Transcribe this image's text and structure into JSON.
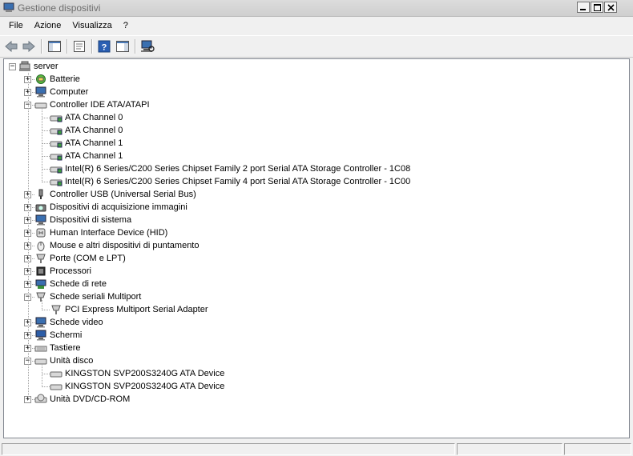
{
  "window": {
    "title": "Gestione dispositivi"
  },
  "menu": [
    "File",
    "Azione",
    "Visualizza",
    "?"
  ],
  "toolbar": [
    {
      "name": "back-icon"
    },
    {
      "name": "forward-icon"
    },
    {
      "name": "show-hide-console-tree-icon"
    },
    {
      "name": "properties-icon"
    },
    {
      "name": "help-icon"
    },
    {
      "name": "show-action-pane-icon"
    },
    {
      "name": "scan-hardware-changes-icon"
    }
  ],
  "tree": {
    "root": "server",
    "items": [
      {
        "label": "Batterie",
        "icon": "battery-icon",
        "state": "+"
      },
      {
        "label": "Computer",
        "icon": "computer-icon",
        "state": "+"
      },
      {
        "label": "Controller IDE ATA/ATAPI",
        "icon": "ide-controller-icon",
        "state": "-",
        "children": [
          "ATA Channel 0",
          "ATA Channel 0",
          "ATA Channel 1",
          "ATA Channel 1",
          "Intel(R) 6 Series/C200 Series Chipset Family 2 port Serial ATA Storage Controller - 1C08",
          "Intel(R) 6 Series/C200 Series Chipset Family 4 port Serial ATA Storage Controller - 1C00"
        ]
      },
      {
        "label": "Controller USB (Universal Serial Bus)",
        "icon": "usb-icon",
        "state": "+"
      },
      {
        "label": "Dispositivi di acquisizione immagini",
        "icon": "camera-icon",
        "state": "+"
      },
      {
        "label": "Dispositivi di sistema",
        "icon": "system-device-icon",
        "state": "+"
      },
      {
        "label": "Human Interface Device (HID)",
        "icon": "hid-icon",
        "state": "+"
      },
      {
        "label": "Mouse e altri dispositivi di puntamento",
        "icon": "mouse-icon",
        "state": "+"
      },
      {
        "label": "Porte (COM e LPT)",
        "icon": "port-icon",
        "state": "+"
      },
      {
        "label": "Processori",
        "icon": "processor-icon",
        "state": "+"
      },
      {
        "label": "Schede di rete",
        "icon": "network-adapter-icon",
        "state": "+"
      },
      {
        "label": "Schede seriali Multiport",
        "icon": "multiport-icon",
        "state": "-",
        "children": [
          "PCI Express Multiport Serial Adapter"
        ]
      },
      {
        "label": "Schede video",
        "icon": "display-adapter-icon",
        "state": "+"
      },
      {
        "label": "Schermi",
        "icon": "monitor-icon",
        "state": "+"
      },
      {
        "label": "Tastiere",
        "icon": "keyboard-icon",
        "state": "+"
      },
      {
        "label": "Unità disco",
        "icon": "disk-drive-icon",
        "state": "-",
        "children": [
          "KINGSTON SVP200S3240G ATA Device",
          "KINGSTON SVP200S3240G ATA Device"
        ]
      },
      {
        "label": "Unità DVD/CD-ROM",
        "icon": "dvd-drive-icon",
        "state": "+"
      }
    ]
  },
  "colors": {
    "titlebar": "#d4d4d4",
    "tree_bg": "#ffffff",
    "window_bg": "#f0f0f0"
  }
}
